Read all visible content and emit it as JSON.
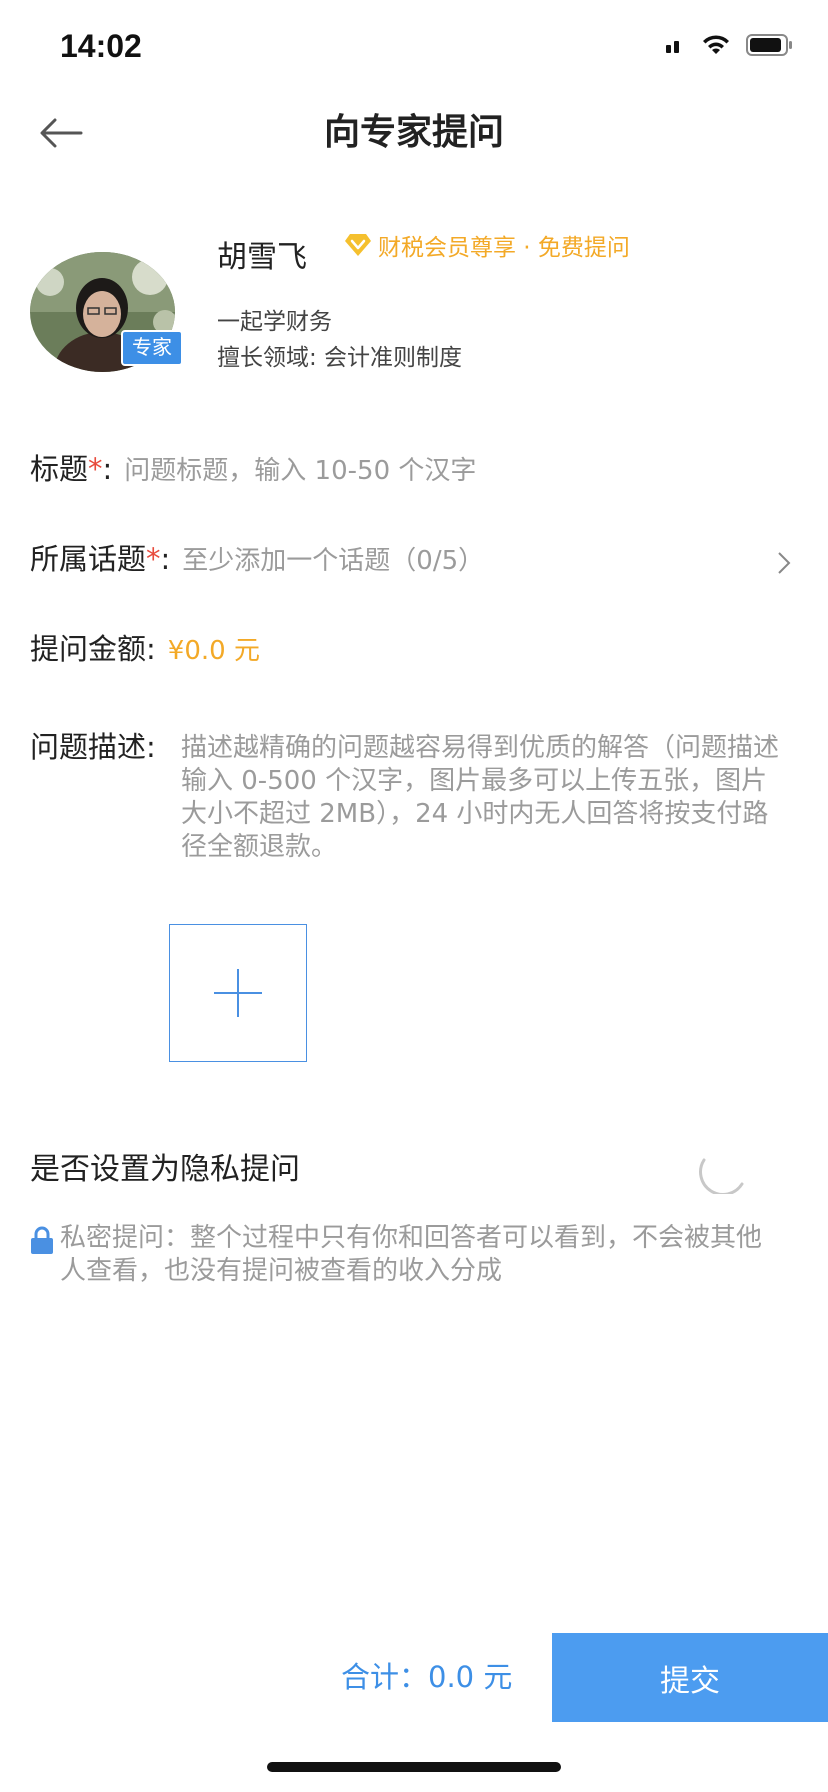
{
  "status_bar": {
    "time": "14:02"
  },
  "nav": {
    "title": "向专家提问"
  },
  "expert": {
    "name": "胡雪飞",
    "vip_text": "财税会员尊享 · 免费提问",
    "badge": "专家",
    "org": "一起学财务",
    "field": "擅长领域: 会计准则制度"
  },
  "form": {
    "title_label": "标题",
    "title_placeholder": "问题标题，输入 10-50 个汉字",
    "topic_label": "所属话题",
    "topic_placeholder": "至少添加一个话题（0/5）",
    "amount_label": "提问金额",
    "amount_value": "¥0.0 元",
    "desc_label": "问题描述",
    "desc_placeholder": "描述越精确的问题越容易得到优质的解答（问题描述输入 0-500 个汉字，图片最多可以上传五张，图片大小不超过 2MB），24 小时内无人回答将按支付路径全额退款。",
    "required_mark": "*",
    "colon": ":"
  },
  "privacy": {
    "title": "是否设置为隐私提问",
    "note": "私密提问：整个过程中只有你和回答者可以看到，不会被其他人查看，也没有提问被查看的收入分成"
  },
  "footer": {
    "total_label": "合计：",
    "total_value": "0.0 元",
    "submit": "提交"
  },
  "colors": {
    "accent": "#4c9cf0",
    "gold": "#f3a927",
    "required": "#e84b3c",
    "placeholder": "#9b9b9b"
  }
}
